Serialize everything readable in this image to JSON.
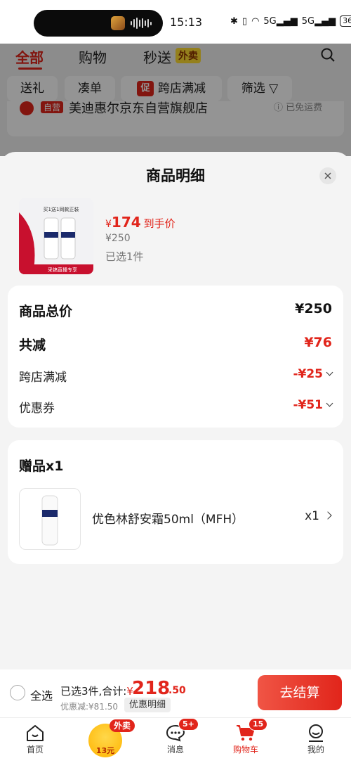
{
  "status_bar": {
    "time": "15:13",
    "network": "5G",
    "battery": "36"
  },
  "background": {
    "tabs": [
      {
        "label": "全部"
      },
      {
        "label": "购物"
      },
      {
        "label": "秒送"
      }
    ],
    "waimai_tag": "外卖",
    "chips": [
      {
        "label": "送礼"
      },
      {
        "label": "凑单"
      },
      {
        "label": "跨店满减",
        "tag": "促"
      },
      {
        "label": "筛选"
      }
    ],
    "shop": {
      "tag": "自营",
      "name": "美迪惠尔京东自营旗舰店",
      "shipping": "已免运费"
    }
  },
  "sheet": {
    "title": "商品明细",
    "product": {
      "price_yen": "¥",
      "price": "174",
      "price_label": "到手价",
      "original_price": "¥250",
      "selected_count": "已选1件",
      "img_banner": "采镐直播专享",
      "img_text": "买1送1同款正装"
    },
    "summary": {
      "total_label": "商品总价",
      "total_value": "¥250",
      "reduce_label": "共减",
      "reduce_value": "¥76",
      "items": [
        {
          "label": "跨店满减",
          "value": "-¥25"
        },
        {
          "label": "优惠券",
          "value": "-¥51"
        }
      ]
    },
    "gift": {
      "title": "赠品x1",
      "name": "优色林舒安霜50ml（MFH）",
      "qty": "x1"
    }
  },
  "checkout": {
    "select_all": "全选",
    "summary_prefix": "已选3件,合计:",
    "yen": "¥",
    "total_int": "218",
    "total_dec": ".50",
    "discount": "优惠减:¥81.50",
    "detail_button": "优惠明细",
    "pay_button": "去结算"
  },
  "nav": {
    "items": [
      {
        "label": "首页"
      },
      {
        "label": "消息",
        "badge": "5+"
      },
      {
        "label": "购物车",
        "badge": "15"
      },
      {
        "label": "我的"
      }
    ],
    "coupon_value": "13元",
    "coupon_tag": "外卖"
  },
  "colors": {
    "accent": "#e1251b",
    "pay_gradient": "#f05545"
  }
}
